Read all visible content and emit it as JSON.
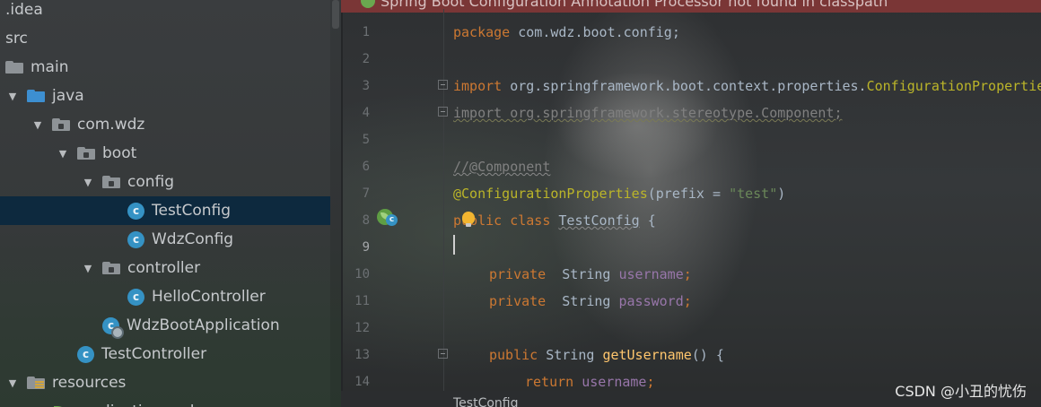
{
  "project": {
    "items": [
      {
        "label": ".idea",
        "depth": 0,
        "arrow": "none",
        "icon": "none"
      },
      {
        "label": "src",
        "depth": 0,
        "arrow": "none",
        "icon": "none"
      },
      {
        "label": "main",
        "depth": 0,
        "arrow": "none",
        "icon": "folder-icon"
      },
      {
        "label": "java",
        "depth": 0,
        "arrow": "expanded",
        "icon": "source-folder-icon"
      },
      {
        "label": "com.wdz",
        "depth": 1,
        "arrow": "expanded",
        "icon": "package-icon"
      },
      {
        "label": "boot",
        "depth": 2,
        "arrow": "expanded",
        "icon": "package-icon"
      },
      {
        "label": "config",
        "depth": 3,
        "arrow": "expanded",
        "icon": "package-icon"
      },
      {
        "label": "TestConfig",
        "depth": 4,
        "arrow": "none",
        "icon": "class-icon",
        "selected": true
      },
      {
        "label": "WdzConfig",
        "depth": 4,
        "arrow": "none",
        "icon": "class-icon"
      },
      {
        "label": "controller",
        "depth": 3,
        "arrow": "expanded",
        "icon": "package-icon"
      },
      {
        "label": "HelloController",
        "depth": 4,
        "arrow": "none",
        "icon": "class-icon"
      },
      {
        "label": "WdzBootApplication",
        "depth": 3,
        "arrow": "none",
        "icon": "spring-boot-class-icon"
      },
      {
        "label": "TestController",
        "depth": 2,
        "arrow": "none",
        "icon": "class-icon"
      },
      {
        "label": "resources",
        "depth": 0,
        "arrow": "expanded",
        "icon": "resources-folder-icon"
      },
      {
        "label": "application.yml",
        "depth": 1,
        "arrow": "none",
        "icon": "spring-yml-icon"
      }
    ]
  },
  "editor": {
    "banner_text": "Spring Boot Configuration Annotation Processor not found in classpath",
    "line_numbers": [
      "1",
      "2",
      "3",
      "4",
      "5",
      "6",
      "7",
      "8",
      "9",
      "10",
      "11",
      "12",
      "13",
      "14"
    ],
    "current_line": 9,
    "code": {
      "l1_kw": "package",
      "l1_rest": " com.wdz.boot.config;",
      "l3_kw": "import",
      "l3_rest": " org.springframework.boot.context.properties.",
      "l3_cls": "ConfigurationProperties;",
      "l4_text": "import org.springframework.stereotype.Component;",
      "l6_text": "//@Component",
      "l7_ann": "@ConfigurationProperties",
      "l7_open": "(prefix = ",
      "l7_str": "\"test\"",
      "l7_close": ")",
      "l8_kw": "public class ",
      "l8_cls": "TestConfig",
      "l8_rest": " {",
      "l10_kw": "private  ",
      "l10_type": "String ",
      "l10_fld": "username",
      "l10_end": ";",
      "l11_kw": "private  ",
      "l11_type": "String ",
      "l11_fld": "password",
      "l11_end": ";",
      "l13_kw": "public ",
      "l13_type": "String ",
      "l13_fn": "getUsername",
      "l13_rest": "() {",
      "l14_kw": "return ",
      "l14_fld": "username",
      "l14_end": ";"
    },
    "breadcrumb": "TestConfig"
  },
  "watermark": "CSDN @小丑的忧伤",
  "colors": {
    "keyword": "#cc7832",
    "annotation": "#bbb529",
    "field": "#9876aa",
    "string": "#6a8759",
    "method": "#ffc66d",
    "selection": "#0d293e",
    "banner": "#7a3636"
  }
}
